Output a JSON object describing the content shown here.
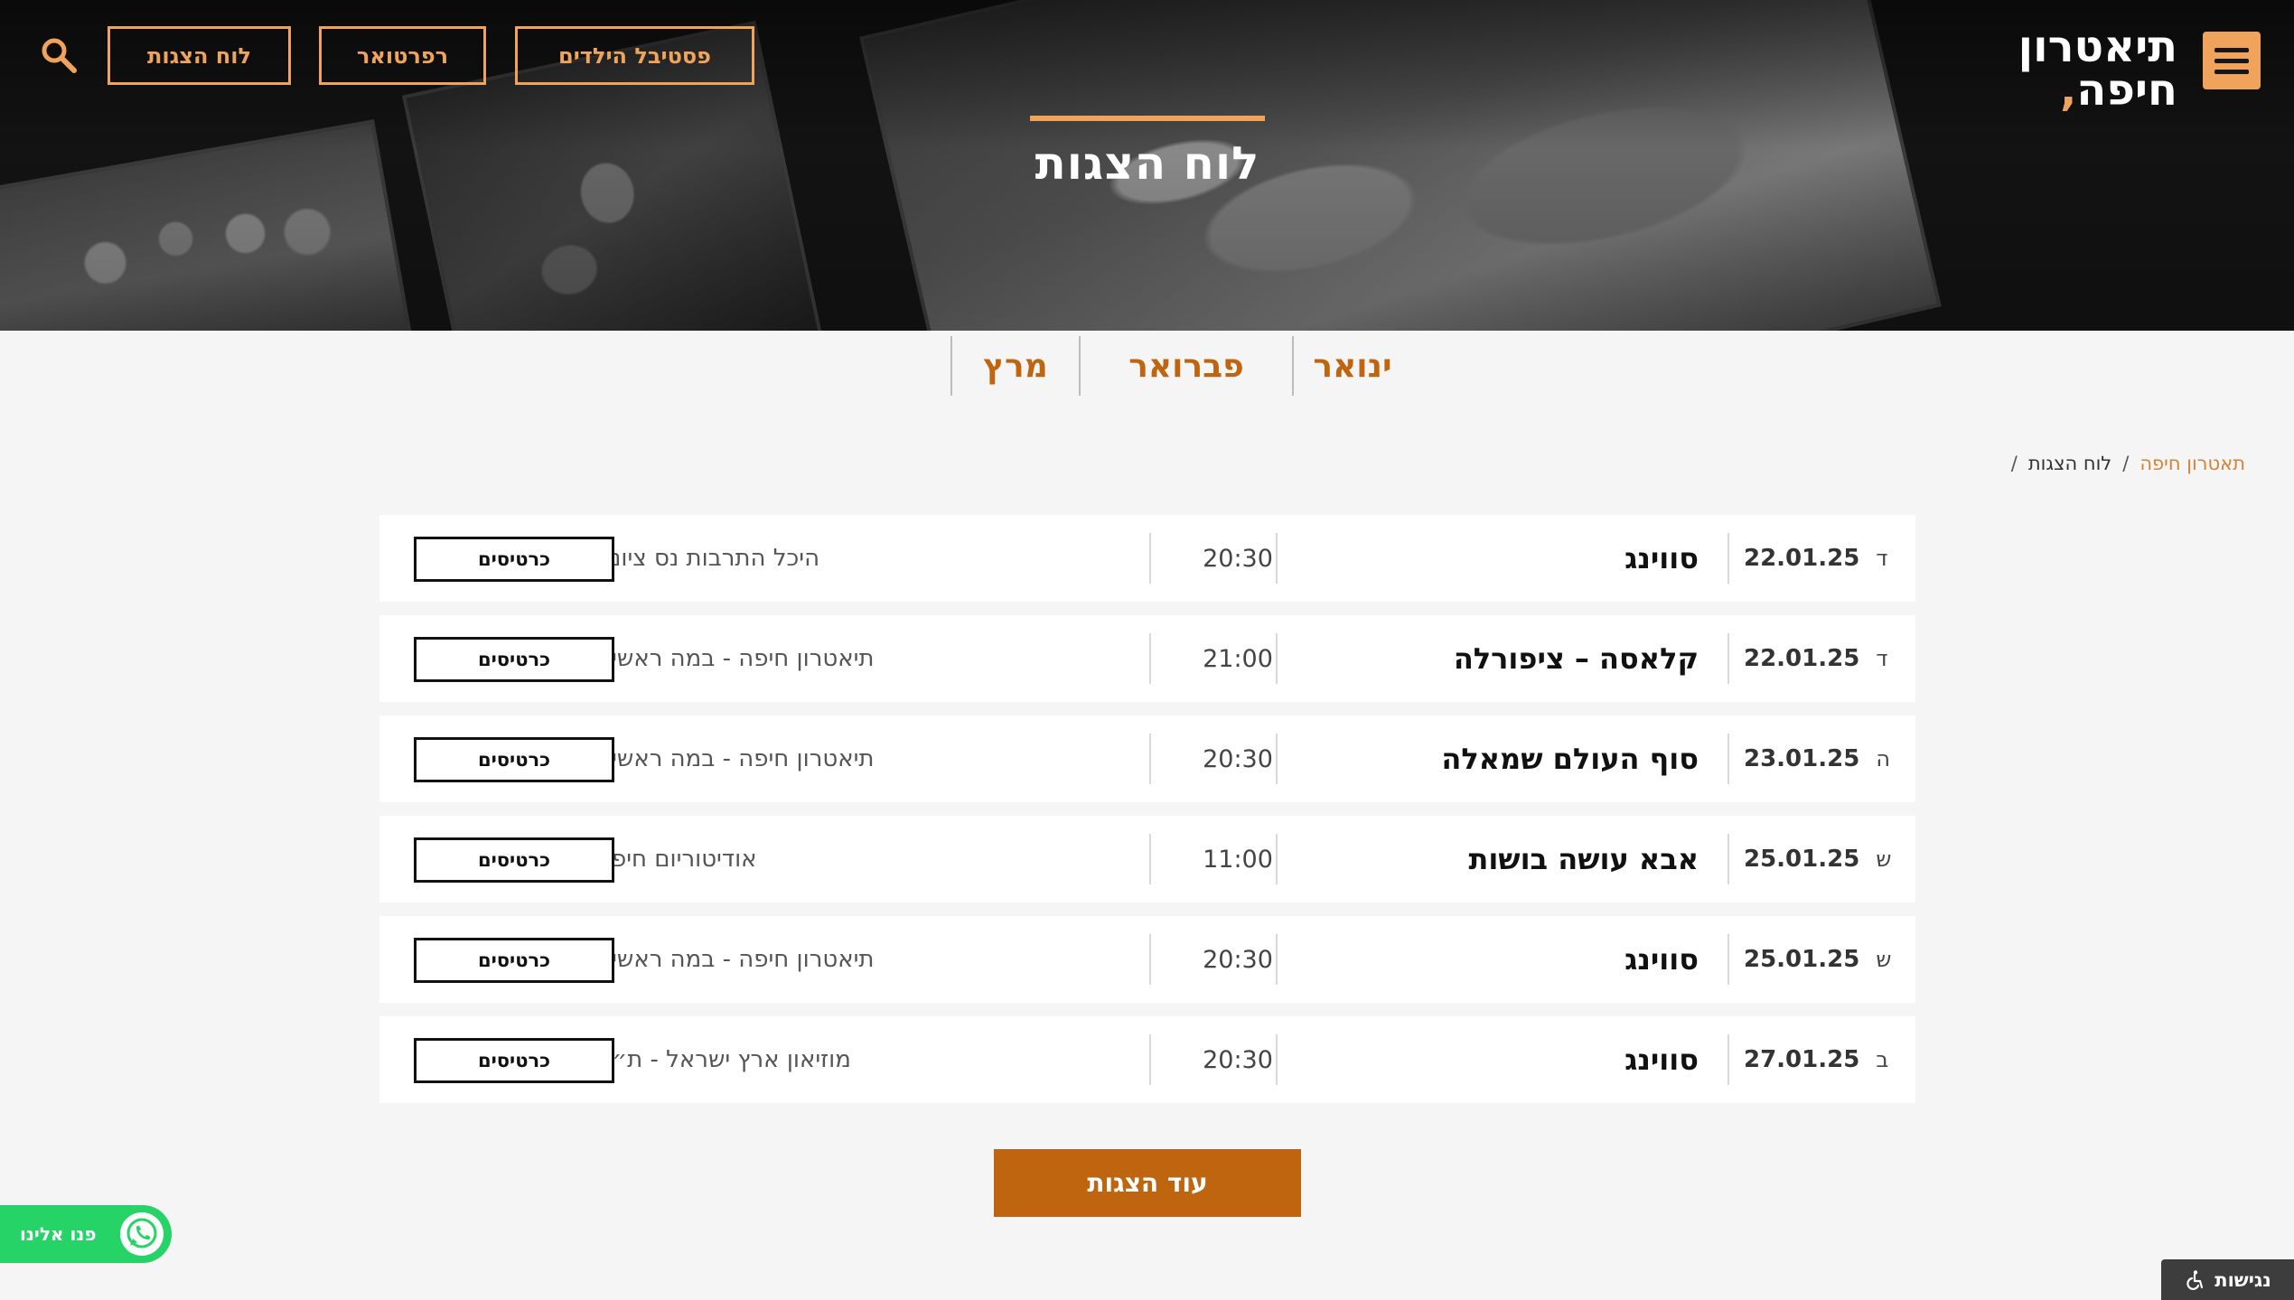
{
  "header": {
    "logo_line1": "תיאטרון",
    "logo_line2": "חיפה",
    "logo_mark": ",",
    "nav": {
      "festival_label": "פסטיבל הילדים",
      "repertoire_label": "רפרטואר",
      "schedule_label": "לוח הצגות"
    },
    "icons": {
      "menu": "hamburger-menu-icon",
      "search": "search-icon"
    },
    "colors": {
      "accent": "#f0a35a",
      "dark": "#161616"
    }
  },
  "hero": {
    "title": "לוח הצגות"
  },
  "months": [
    "ינואר",
    "פברואר",
    "מרץ"
  ],
  "breadcrumb": {
    "home": "תאטרון חיפה",
    "separator": "/",
    "current": "לוח הצגות",
    "trailing_separator": "/"
  },
  "shows": [
    {
      "day": "ד",
      "date": "22.01.25",
      "title": "סווינג",
      "time": "20:30",
      "venue": "היכל התרבות נס ציונה",
      "ticket_label": "כרטיסים"
    },
    {
      "day": "ד",
      "date": "22.01.25",
      "title": "קלאסה – ציפורלה",
      "time": "21:00",
      "venue": "תיאטרון חיפה - במה ראשית",
      "ticket_label": "כרטיסים"
    },
    {
      "day": "ה",
      "date": "23.01.25",
      "title": "סוף העולם שמאלה",
      "time": "20:30",
      "venue": "תיאטרון חיפה - במה ראשית",
      "ticket_label": "כרטיסים"
    },
    {
      "day": "ש",
      "date": "25.01.25",
      "title": "אבא עושה בושות",
      "time": "11:00",
      "venue": "אודיטוריום חיפה",
      "ticket_label": "כרטיסים"
    },
    {
      "day": "ש",
      "date": "25.01.25",
      "title": "סווינג",
      "time": "20:30",
      "venue": "תיאטרון חיפה - במה ראשית",
      "ticket_label": "כרטיסים"
    },
    {
      "day": "ב",
      "date": "27.01.25",
      "title": "סווינג",
      "time": "20:30",
      "venue": "מוזיאון ארץ ישראל - ת״א",
      "ticket_label": "כרטיסים"
    }
  ],
  "more_label": "עוד הצגות",
  "whatsapp": {
    "label": "פנו אלינו",
    "icon": "whatsapp-icon",
    "color": "#25d366"
  },
  "accessibility": {
    "label": "נגישות",
    "icon": "accessibility-icon"
  },
  "colors": {
    "brand_orange": "#c0650f",
    "page_bg": "#f5f5f5"
  }
}
